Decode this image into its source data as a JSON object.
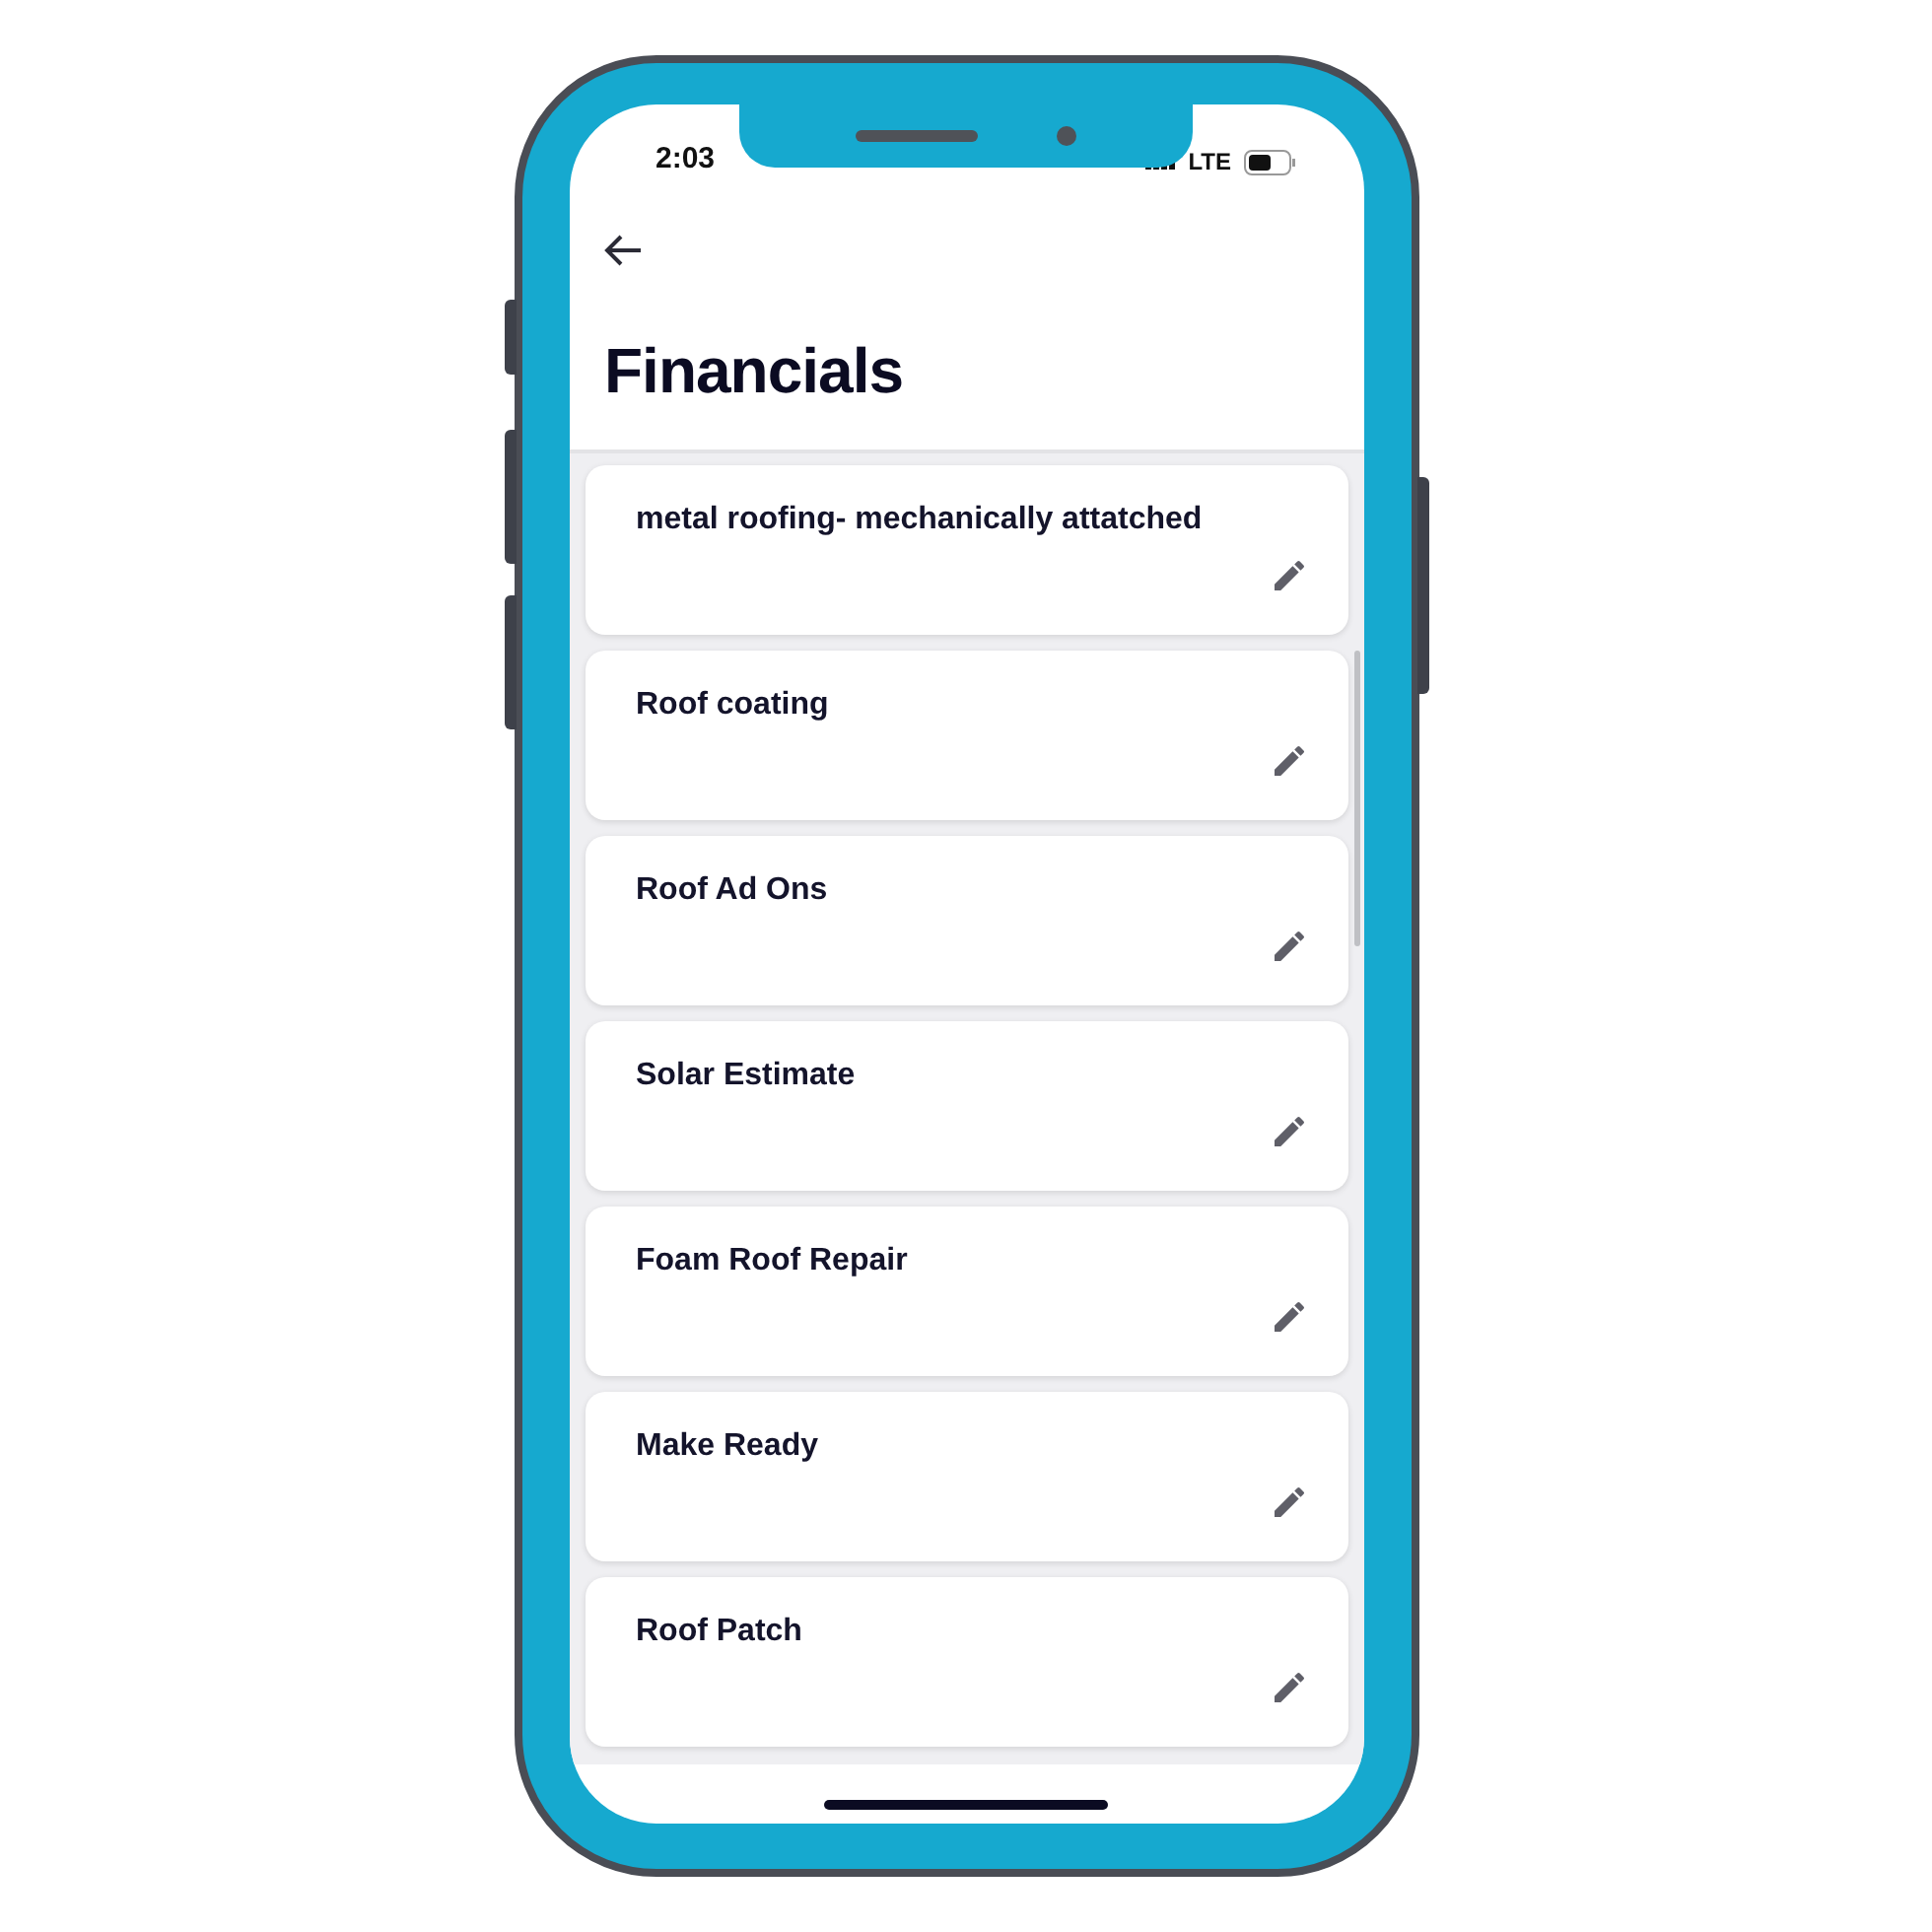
{
  "status_bar": {
    "time": "2:03",
    "network": "LTE"
  },
  "header": {
    "title": "Financials"
  },
  "items": [
    {
      "name": "metal roofing- mechanically attatched"
    },
    {
      "name": "Roof coating"
    },
    {
      "name": "Roof Ad Ons"
    },
    {
      "name": "Solar Estimate"
    },
    {
      "name": "Foam Roof Repair"
    },
    {
      "name": "Make Ready"
    },
    {
      "name": "Roof Patch"
    }
  ]
}
